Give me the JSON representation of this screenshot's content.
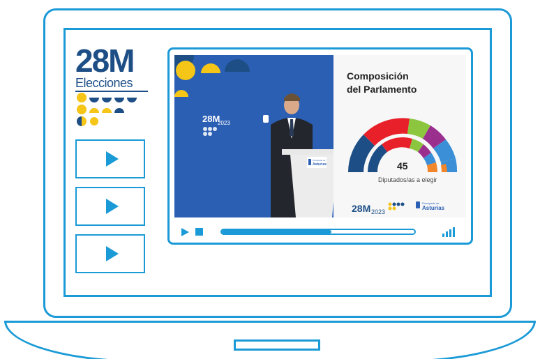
{
  "logo": {
    "title": "28M",
    "subtitle": "Elecciones"
  },
  "playlist": {
    "items": [
      {
        "icon": "play-icon"
      },
      {
        "icon": "play-icon"
      },
      {
        "icon": "play-icon"
      }
    ]
  },
  "video": {
    "backdrop_logo": "28M",
    "backdrop_year": "2023",
    "podium_label_small": "Principado de",
    "podium_label": "Asturias",
    "slide": {
      "title_line1": "Composición",
      "title_line2": "del Parlamento",
      "total_seats": "45",
      "caption": "Diputados/as a elegir",
      "footer_logo": "28M",
      "footer_year": "2023",
      "footer_brand_small": "Principado de",
      "footer_brand": "Asturias"
    }
  },
  "controls": {
    "play_icon": "play-icon",
    "stop_icon": "stop-icon",
    "progress": 0.57,
    "volume_icon": "volume-bars-icon"
  },
  "colors": {
    "accent": "#1a9ad6",
    "brand_navy": "#1d4f86",
    "brand_yellow": "#f5c518"
  }
}
